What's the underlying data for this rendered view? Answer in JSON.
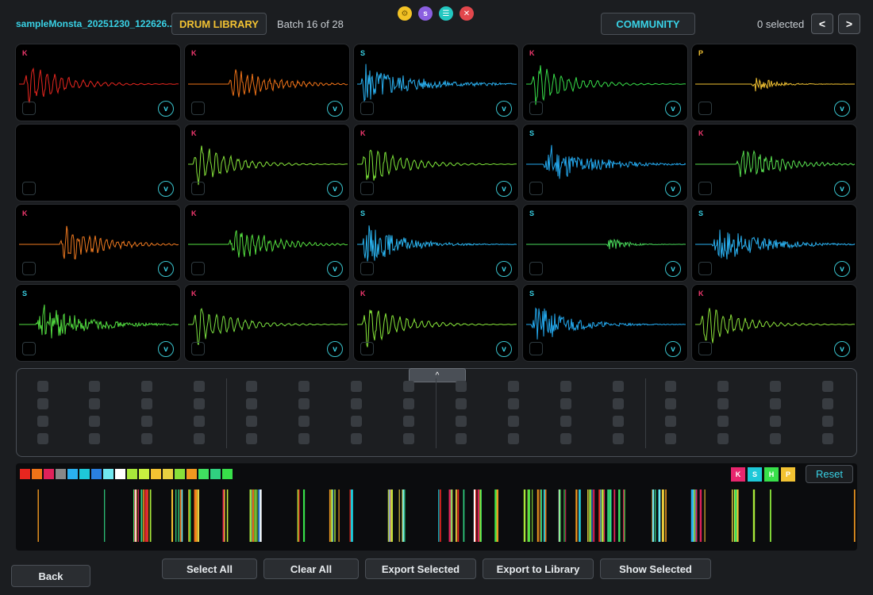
{
  "header": {
    "title": "sampleMonsta_20251230_122626...",
    "library_label": "DRUM LIBRARY",
    "batch_text": "Batch 16 of 28",
    "community_label": "COMMUNITY",
    "selected_text": "0 selected",
    "prev_label": "<",
    "next_label": ">",
    "window_dots": [
      {
        "icon": "settings-icon",
        "glyph": "⚙",
        "color": "#f3c325"
      },
      {
        "icon": "s-icon",
        "glyph": "s",
        "color": "#8b5fe0"
      },
      {
        "icon": "menu-icon",
        "glyph": "☰",
        "color": "#22c7c0"
      },
      {
        "icon": "close-icon",
        "glyph": "✕",
        "color": "#e2474c"
      }
    ]
  },
  "sample_grid": [
    {
      "tag": "K",
      "color": "#e8261f",
      "shape": "kick-early"
    },
    {
      "tag": "K",
      "color": "#f07318",
      "shape": "kick-mid"
    },
    {
      "tag": "S",
      "color": "#2ab0f0",
      "shape": "snare-long"
    },
    {
      "tag": "K",
      "color": "#38e04a",
      "shape": "kick-early"
    },
    {
      "tag": "P",
      "color": "#f2c232",
      "shape": "perc-mid"
    },
    {
      "tag": "",
      "color": "",
      "shape": "empty"
    },
    {
      "tag": "K",
      "color": "#86e43a",
      "shape": "kick-early"
    },
    {
      "tag": "K",
      "color": "#7ee83a",
      "shape": "kick-early"
    },
    {
      "tag": "S",
      "color": "#24aaf0",
      "shape": "snare-mid"
    },
    {
      "tag": "K",
      "color": "#58e050",
      "shape": "kick-mid"
    },
    {
      "tag": "K",
      "color": "#f07a20",
      "shape": "kick-mid"
    },
    {
      "tag": "K",
      "color": "#55e040",
      "shape": "kick-mid"
    },
    {
      "tag": "S",
      "color": "#2ab4f0",
      "shape": "snare-early"
    },
    {
      "tag": "S",
      "color": "#48d85a",
      "shape": "snare-late"
    },
    {
      "tag": "S",
      "color": "#2ab0f0",
      "shape": "snare-mid"
    },
    {
      "tag": "S",
      "color": "#52dc40",
      "shape": "snare-mid"
    },
    {
      "tag": "K",
      "color": "#7ae040",
      "shape": "kick-early"
    },
    {
      "tag": "K",
      "color": "#88e83a",
      "shape": "kick-early"
    },
    {
      "tag": "S",
      "color": "#24aaf0",
      "shape": "snare-early"
    },
    {
      "tag": "K",
      "color": "#8ae03a",
      "shape": "kick-early"
    }
  ],
  "sample_tag_colors": {
    "K": "#f0386e",
    "S": "#39d2e6",
    "P": "#f2c232"
  },
  "sequencer": {
    "collapse_label": "^",
    "rows": 4,
    "columns": 16
  },
  "timeline": {
    "swatches": [
      "#e8261f",
      "#f07318",
      "#e0225a",
      "#888888",
      "#2ab0f0",
      "#1ec8d8",
      "#2a80e0",
      "#70e8f0",
      "#ffffff",
      "#a8e83a",
      "#c8f040",
      "#f2c232",
      "#e8d040",
      "#88e03a",
      "#f09820",
      "#40e060",
      "#30d080",
      "#38e04a"
    ],
    "filters": [
      {
        "label": "K",
        "color": "#e8266e"
      },
      {
        "label": "S",
        "color": "#1ec8d8"
      },
      {
        "label": "H",
        "color": "#38e04a"
      },
      {
        "label": "P",
        "color": "#f2c232"
      }
    ],
    "reset_label": "Reset"
  },
  "footer": {
    "back_label": "Back",
    "select_all": "Select All",
    "clear_all": "Clear All",
    "export_selected": "Export Selected",
    "export_library": "Export to Library",
    "show_selected": "Show Selected"
  }
}
